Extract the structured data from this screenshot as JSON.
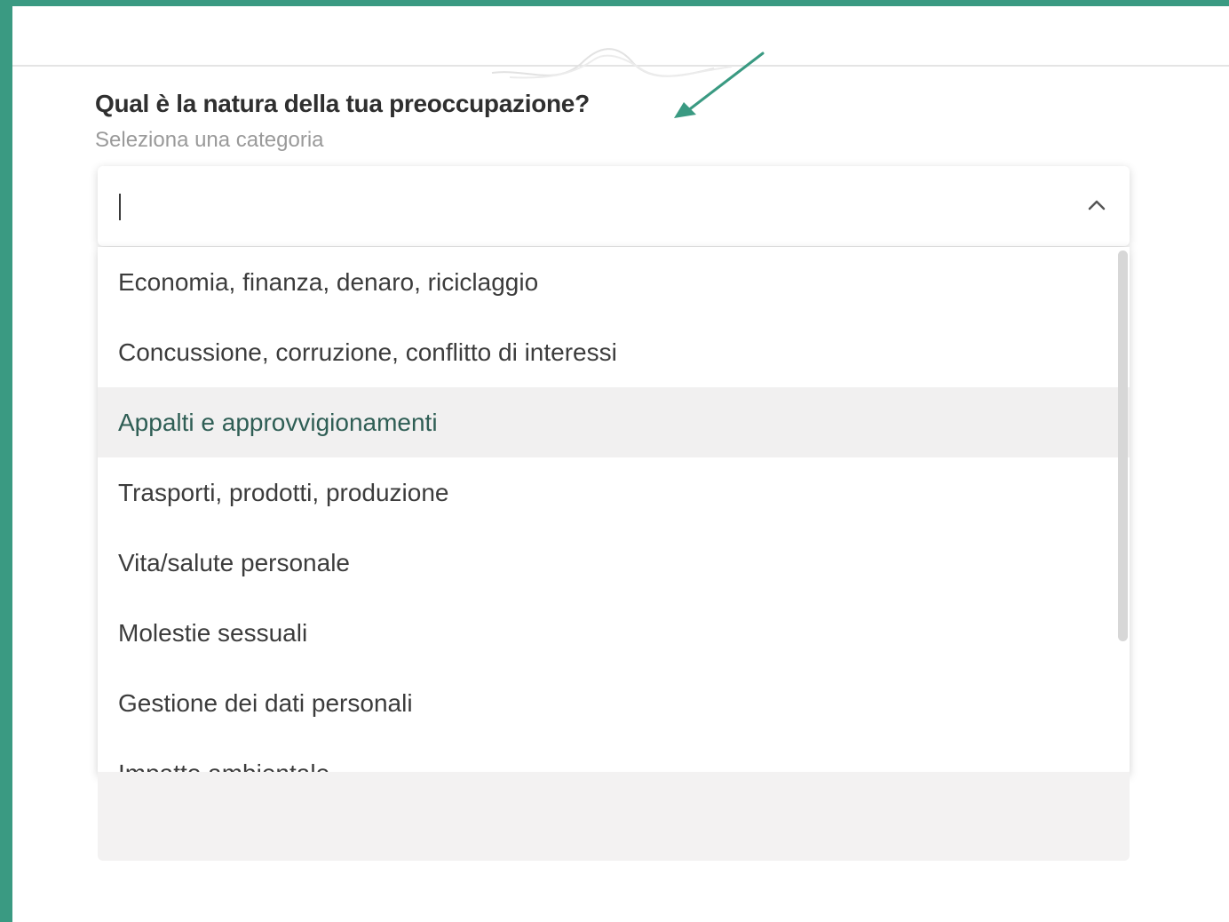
{
  "form": {
    "question": "Qual è la natura della tua preoccupazione?",
    "hint": "Seleziona una categoria",
    "select_value": ""
  },
  "options": [
    {
      "label": "Economia, finanza, denaro, riciclaggio"
    },
    {
      "label": "Concussione, corruzione, conflitto di interessi"
    },
    {
      "label": "Appalti e approvvigionamenti",
      "highlighted": true
    },
    {
      "label": "Trasporti, prodotti, produzione"
    },
    {
      "label": "Vita/salute personale"
    },
    {
      "label": "Molestie sessuali"
    },
    {
      "label": "Gestione dei dati personali"
    },
    {
      "label": "Impatto ambientale"
    }
  ],
  "colors": {
    "frame": "#3a9a82",
    "arrow": "#3a9a82",
    "highlight_bg": "#f1f0f0",
    "highlight_text": "#2f5e55"
  },
  "icons": {
    "select_toggle": "chevron-up-icon",
    "annotation": "arrow-icon"
  }
}
